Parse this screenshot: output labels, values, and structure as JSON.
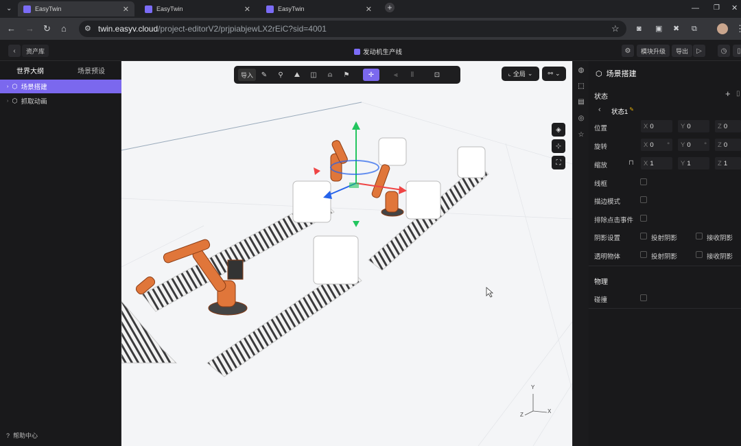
{
  "browser": {
    "tabs": [
      {
        "title": "EasyTwin"
      },
      {
        "title": "EasyTwin"
      },
      {
        "title": "EasyTwin"
      }
    ],
    "url_host": "twin.easyv.cloud",
    "url_path": "/project-editorV2/prjpiabjewLX2rEiC?sid=4001"
  },
  "app": {
    "back_label": "资产库",
    "project_title": "发动机生产线",
    "module_upgrade": "模块升级",
    "export": "导出"
  },
  "left_panel": {
    "tabs": [
      "世界大纲",
      "场景预设"
    ],
    "tree": [
      "场景搭建",
      "抓取动画"
    ],
    "help": "帮助中心"
  },
  "viewport": {
    "import_label": "导入",
    "global_label": "全局",
    "axes": {
      "x": "X",
      "y": "Y",
      "z": "Z"
    }
  },
  "right_panel": {
    "title": "场景搭建",
    "state_label": "状态",
    "state_name": "状态1",
    "position_label": "位置",
    "rotation_label": "旋转",
    "scale_label": "缩放",
    "position": {
      "x": "0",
      "y": "0",
      "z": "0"
    },
    "rotation": {
      "x": "0",
      "y": "0",
      "z": "0"
    },
    "scale": {
      "x": "1",
      "y": "1",
      "z": "1"
    },
    "wireframe_label": "线框",
    "outline_label": "描边模式",
    "exclude_click_label": "排除点击事件",
    "shadow_label": "阴影设置",
    "cast_shadow": "投射阴影",
    "receive_shadow": "接收阴影",
    "transparent_label": "透明物体",
    "physics_section": "物理",
    "collision_label": "碰撞"
  }
}
